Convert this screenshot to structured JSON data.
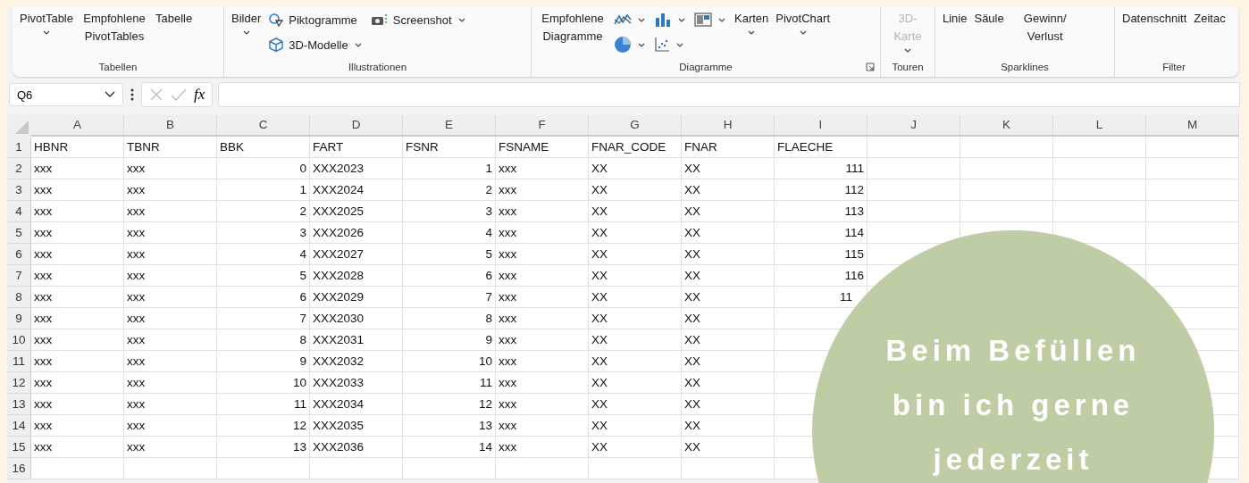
{
  "ribbon": {
    "groups": [
      {
        "label": "Tabellen",
        "columns": [
          [
            {
              "kind": "large",
              "label": "PivotTable",
              "caret": true
            }
          ],
          [
            {
              "kind": "large",
              "label": "Empfohlene PivotTables"
            }
          ],
          [
            {
              "kind": "large",
              "label": "Tabelle"
            }
          ]
        ]
      },
      {
        "label": "Illustrationen",
        "columns": [
          [
            {
              "kind": "large",
              "label": "Bilder",
              "caret": true
            }
          ],
          [
            {
              "kind": "pictogram",
              "label": "Piktogramme"
            },
            {
              "kind": "cube",
              "label": "3D-Modelle",
              "caret": true
            }
          ],
          [
            {
              "kind": "camera",
              "label": "Screenshot",
              "caret": true
            }
          ]
        ]
      },
      {
        "label": "Diagramme",
        "launcher": true,
        "columns": [
          [
            {
              "kind": "large",
              "label": "Empfohlene Diagramme"
            }
          ],
          [
            {
              "kind": "linechart",
              "caret": true
            },
            {
              "kind": "piechart",
              "caret": true
            }
          ],
          [
            {
              "kind": "barchart",
              "caret": true
            },
            {
              "kind": "scatterchart",
              "caret": true
            }
          ],
          [
            {
              "kind": "hierarchychart",
              "caret": true
            }
          ],
          [
            {
              "kind": "large",
              "label": "Karten",
              "caret": true
            }
          ],
          [
            {
              "kind": "large",
              "label": "PivotChart",
              "caret": true
            }
          ]
        ]
      },
      {
        "label": "Touren",
        "columns": [
          [
            {
              "kind": "large",
              "label": "3D-Karte",
              "caret": true,
              "disabled": true
            }
          ]
        ]
      },
      {
        "label": "Sparklines",
        "columns": [
          [
            {
              "kind": "large",
              "label": "Linie"
            }
          ],
          [
            {
              "kind": "large",
              "label": "Säule"
            }
          ],
          [
            {
              "kind": "large",
              "label": "Gewinn/ Verlust"
            }
          ]
        ]
      },
      {
        "label": "Filter",
        "columns": [
          [
            {
              "kind": "large",
              "label": "Datenschnitt"
            }
          ],
          [
            {
              "kind": "large",
              "label": "Zeitac"
            }
          ]
        ]
      }
    ]
  },
  "formula_bar": {
    "name_box": "Q6",
    "function_label": "fx"
  },
  "sheet": {
    "columns": [
      {
        "letter": "A"
      },
      {
        "letter": "B"
      },
      {
        "letter": "C",
        "numeric": true
      },
      {
        "letter": "D"
      },
      {
        "letter": "E",
        "numeric": true
      },
      {
        "letter": "F"
      },
      {
        "letter": "G"
      },
      {
        "letter": "H"
      },
      {
        "letter": "I",
        "numeric": true
      },
      {
        "letter": "J"
      },
      {
        "letter": "K"
      },
      {
        "letter": "L"
      },
      {
        "letter": "M"
      }
    ],
    "rows": [
      {
        "number": "1",
        "cells": [
          "HBNR",
          "TBNR",
          "BBK",
          "FART",
          "FSNR",
          "FSNAME",
          "FNAR_CODE",
          "FNAR",
          "FLAECHE"
        ],
        "header": true
      },
      {
        "number": "2",
        "cells": [
          "xxx",
          "xxx",
          "0",
          "XXX2023",
          "1",
          "xxx",
          "XX",
          "XX",
          "111"
        ]
      },
      {
        "number": "3",
        "cells": [
          "xxx",
          "xxx",
          "1",
          "XXX2024",
          "2",
          "xxx",
          "XX",
          "XX",
          "112"
        ]
      },
      {
        "number": "4",
        "cells": [
          "xxx",
          "xxx",
          "2",
          "XXX2025",
          "3",
          "xxx",
          "XX",
          "XX",
          "113"
        ]
      },
      {
        "number": "5",
        "cells": [
          "xxx",
          "xxx",
          "3",
          "XXX2026",
          "4",
          "xxx",
          "XX",
          "XX",
          "114"
        ]
      },
      {
        "number": "6",
        "cells": [
          "xxx",
          "xxx",
          "4",
          "XXX2027",
          "5",
          "xxx",
          "XX",
          "XX",
          "115"
        ]
      },
      {
        "number": "7",
        "cells": [
          "xxx",
          "xxx",
          "5",
          "XXX2028",
          "6",
          "xxx",
          "XX",
          "XX",
          "116"
        ]
      },
      {
        "number": "8",
        "cells": [
          "xxx",
          "xxx",
          "6",
          "XXX2029",
          "7",
          "xxx",
          "XX",
          "XX",
          "11"
        ],
        "partly_covered": true
      },
      {
        "number": "9",
        "cells": [
          "xxx",
          "xxx",
          "7",
          "XXX2030",
          "8",
          "xxx",
          "XX",
          "XX"
        ]
      },
      {
        "number": "10",
        "cells": [
          "xxx",
          "xxx",
          "8",
          "XXX2031",
          "9",
          "xxx",
          "XX",
          "XX"
        ]
      },
      {
        "number": "11",
        "cells": [
          "xxx",
          "xxx",
          "9",
          "XXX2032",
          "10",
          "xxx",
          "XX",
          "XX"
        ]
      },
      {
        "number": "12",
        "cells": [
          "xxx",
          "xxx",
          "10",
          "XXX2033",
          "11",
          "xxx",
          "XX",
          "XX"
        ]
      },
      {
        "number": "13",
        "cells": [
          "xxx",
          "xxx",
          "11",
          "XXX2034",
          "12",
          "xxx",
          "XX",
          "XX"
        ]
      },
      {
        "number": "14",
        "cells": [
          "xxx",
          "xxx",
          "12",
          "XXX2035",
          "13",
          "xxx",
          "XX",
          "XX"
        ]
      },
      {
        "number": "15",
        "cells": [
          "xxx",
          "xxx",
          "13",
          "XXX2036",
          "14",
          "xxx",
          "XX",
          "XX"
        ]
      },
      {
        "number": "16",
        "cells": []
      }
    ]
  },
  "callout": {
    "text": "Beim Befüllen bin ich gerne jederzeit"
  }
}
